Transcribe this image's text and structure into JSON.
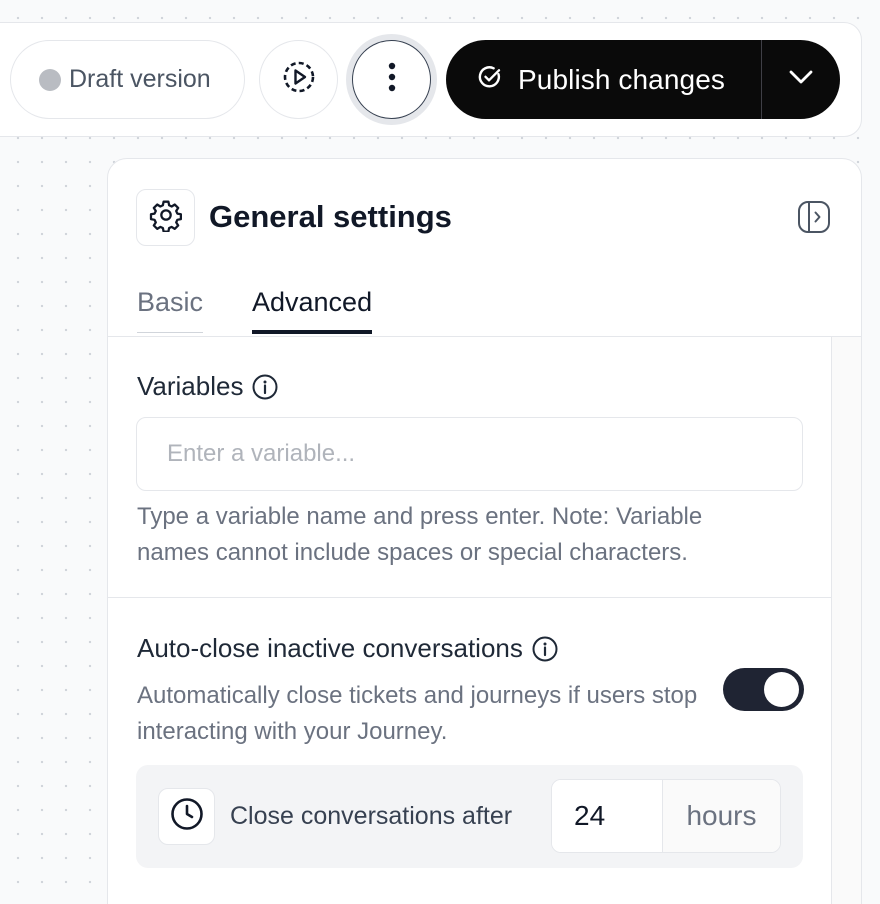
{
  "toolbar": {
    "draft_label": "Draft version",
    "publish_label": "Publish changes"
  },
  "panel": {
    "title": "General settings",
    "tabs": [
      {
        "label": "Basic",
        "active": false
      },
      {
        "label": "Advanced",
        "active": true
      }
    ]
  },
  "variables": {
    "label": "Variables",
    "placeholder": "Enter a variable...",
    "value": "",
    "help": "Type a variable name and press enter. Note: Variable names cannot include spaces or special characters."
  },
  "auto_close": {
    "label": "Auto-close inactive conversations",
    "description": "Automatically close tickets and journeys if users stop interacting with your Journey.",
    "enabled": true,
    "close_after_label": "Close conversations after",
    "hours_value": "24",
    "unit": "hours"
  },
  "colors": {
    "primary_button": "#0a0a0a",
    "toggle_on": "#1f2433",
    "draft_dot": "#b9bcc2"
  }
}
